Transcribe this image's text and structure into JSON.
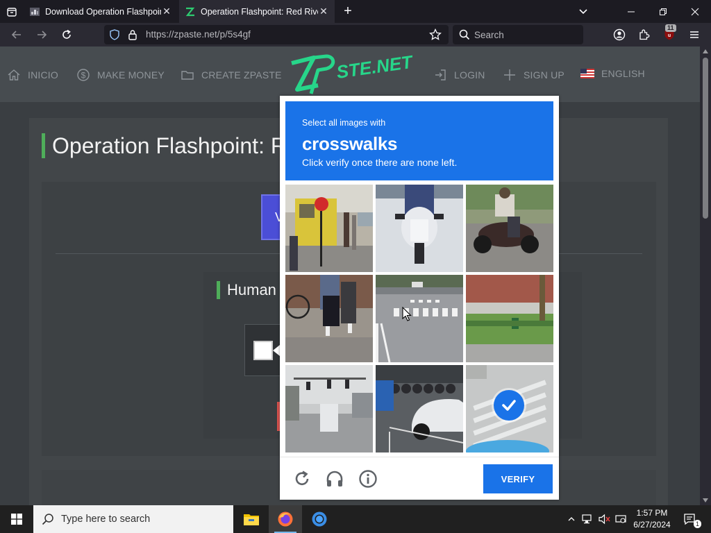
{
  "browser": {
    "tabs": [
      {
        "title": "Download Operation Flashpoint: Red River",
        "active": false
      },
      {
        "title": "Operation Flashpoint: Red River",
        "active": true
      }
    ],
    "url": "https://zpaste.net/p/5s4gf",
    "search_placeholder": "Search",
    "extension_badge": "11"
  },
  "site": {
    "nav": [
      {
        "label": "INICIO",
        "icon": "home-icon"
      },
      {
        "label": "MAKE MONEY",
        "icon": "dollar-icon"
      },
      {
        "label": "CREATE ZPASTE",
        "icon": "folder-icon"
      },
      {
        "label": "LOGIN",
        "icon": "login-icon"
      },
      {
        "label": "SIGN UP",
        "icon": "plus-icon"
      },
      {
        "label": "ENGLISH",
        "icon": "us-flag-icon"
      }
    ],
    "logo": "ZPASTE.NET",
    "page_title": "Operation Flashpoint: Red River",
    "purple_button_label": "V",
    "human_verification_title": "Human Verification"
  },
  "captcha": {
    "instruction_line1": "Select all images with",
    "target_word": "crosswalks",
    "instruction_line3": "Click verify once there are none left.",
    "verify_label": "VERIFY",
    "tiles": [
      {
        "name": "street-sign-pedestrians",
        "selected": false
      },
      {
        "name": "scooter-rider",
        "selected": false
      },
      {
        "name": "motorcycle-rider",
        "selected": false
      },
      {
        "name": "bicycle-pedestrians",
        "selected": false
      },
      {
        "name": "road-crosswalk",
        "selected": false
      },
      {
        "name": "park-lawn",
        "selected": false
      },
      {
        "name": "traffic-lights-street",
        "selected": false
      },
      {
        "name": "parked-cars",
        "selected": false
      },
      {
        "name": "crosswalk-selected",
        "selected": true
      }
    ],
    "accent_color": "#1a73e8"
  },
  "taskbar": {
    "search_placeholder": "Type here to search",
    "time": "1:57 PM",
    "date": "6/27/2024",
    "notification_count": "1"
  }
}
